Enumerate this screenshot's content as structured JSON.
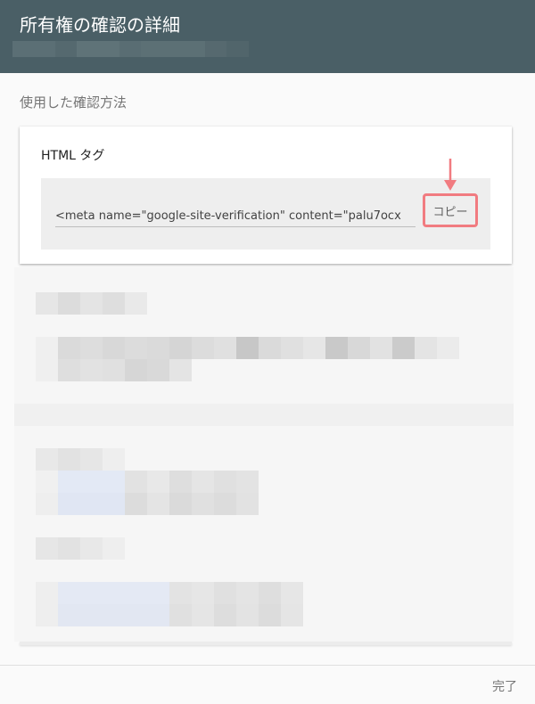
{
  "header": {
    "title": "所有権の確認の詳細"
  },
  "section": {
    "label": "使用した確認方法"
  },
  "card": {
    "title": "HTML タグ",
    "code": "<meta name=\"google-site-verification\" content=\"palu7ocx",
    "copy_label": "コピー"
  },
  "footer": {
    "done_label": "完了"
  },
  "colors": {
    "header_bg": "#4a5f66",
    "highlight": "#f17b80"
  }
}
